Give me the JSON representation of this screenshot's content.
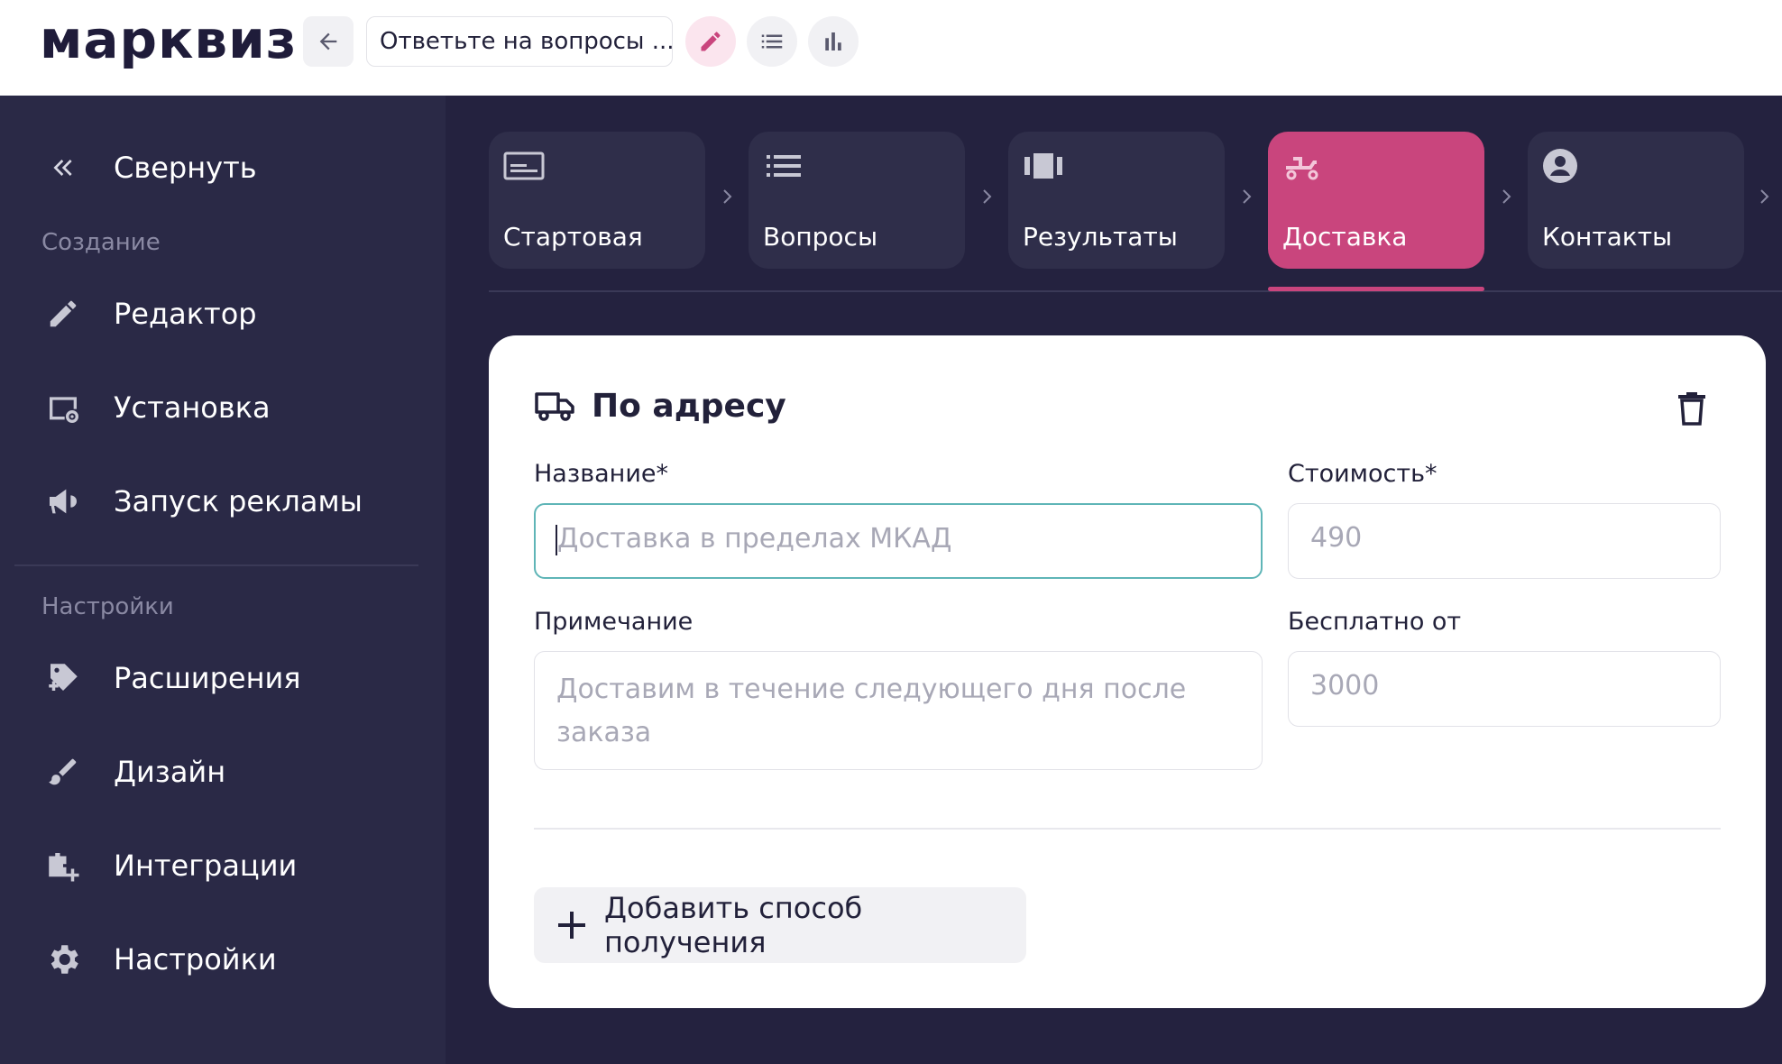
{
  "header": {
    "logo": "марквиз",
    "quiz_title": "Ответьте на вопросы ..."
  },
  "sidebar": {
    "collapse_label": "Свернуть",
    "section_create": "Создание",
    "section_settings": "Настройки",
    "items": [
      {
        "label": "Редактор",
        "icon": "pencil-icon"
      },
      {
        "label": "Установка",
        "icon": "install-icon"
      },
      {
        "label": "Запуск рекламы",
        "icon": "megaphone-icon"
      },
      {
        "label": "Расширения",
        "icon": "puzzle-icon"
      },
      {
        "label": "Дизайн",
        "icon": "brush-icon"
      },
      {
        "label": "Интеграции",
        "icon": "integrations-icon"
      },
      {
        "label": "Настройки",
        "icon": "gear-icon"
      }
    ]
  },
  "tabs": [
    {
      "label": "Стартовая",
      "icon": "start-page-icon"
    },
    {
      "label": "Вопросы",
      "icon": "questions-list-icon"
    },
    {
      "label": "Результаты",
      "icon": "results-icon"
    },
    {
      "label": "Доставка",
      "icon": "delivery-icon",
      "active": true
    },
    {
      "label": "Контакты",
      "icon": "contacts-icon"
    }
  ],
  "delivery": {
    "method_title": "По адресу",
    "name_label": "Название*",
    "name_placeholder": "Доставка в пределах МКАД",
    "cost_label": "Стоимость*",
    "cost_placeholder": "490",
    "note_label": "Примечание",
    "note_placeholder": "Доставим в течение следующего дня после заказа",
    "free_from_label": "Бесплатно от",
    "free_from_placeholder": "3000",
    "add_button_label": "Добавить способ получения"
  },
  "colors": {
    "accent": "#c9457d",
    "sidebar_bg": "#2a2946",
    "page_bg": "#24223f",
    "focus_border": "#5fb5b7"
  }
}
